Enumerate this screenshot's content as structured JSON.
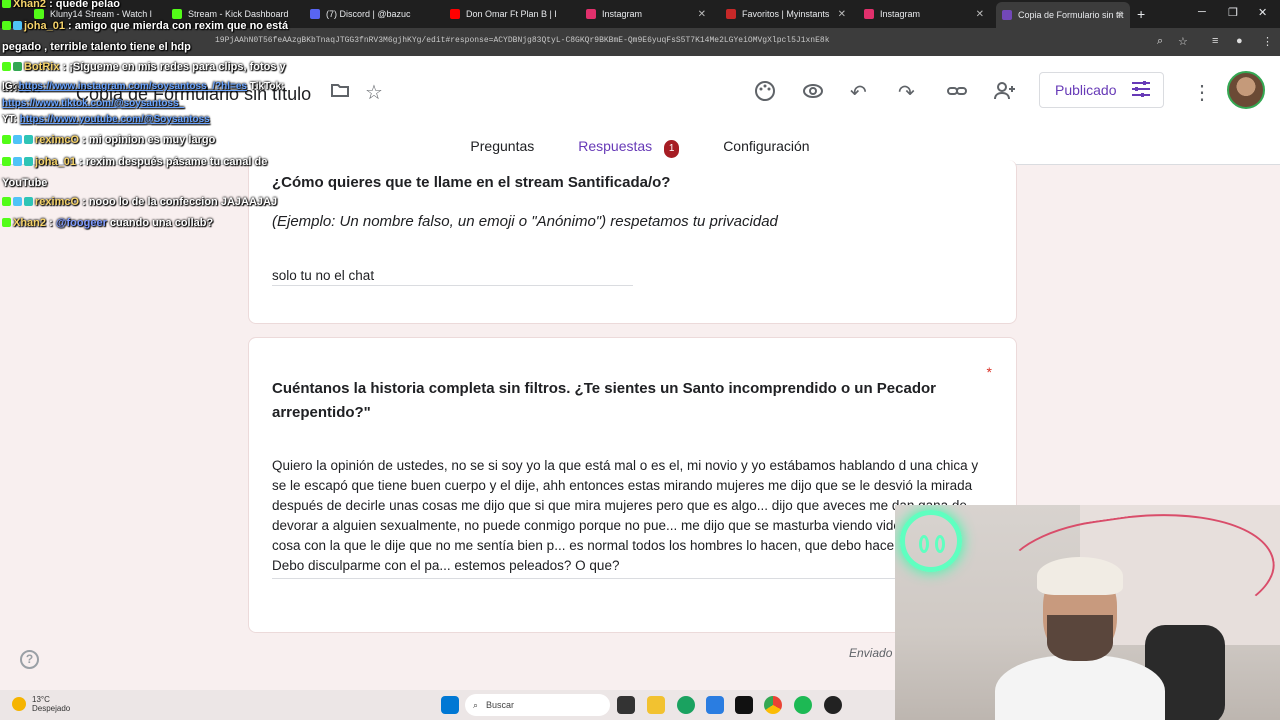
{
  "browser": {
    "tabs": [
      {
        "title": "Kluny14 Stream - Watch l",
        "color": "#53fc18",
        "active": false
      },
      {
        "title": "Stream - Kick Dashboard",
        "color": "#53fc18",
        "active": false
      },
      {
        "title": "(7) Discord | @bazuc",
        "color": "#5865f2",
        "active": false
      },
      {
        "title": "Don Omar Ft Plan B | Hoo",
        "color": "#ff0000",
        "active": false
      },
      {
        "title": "Instagram",
        "color": "#e1306c",
        "active": false
      },
      {
        "title": "Favoritos | Myinstants",
        "color": "#c62828",
        "active": false
      },
      {
        "title": "Instagram",
        "color": "#e1306c",
        "active": false
      },
      {
        "title": "Copia de Formulario sin tít",
        "color": "#7248b9",
        "active": true
      }
    ],
    "url": "19PjAAhN0T56feAAzgBKbTnaqJTGG3fnRV3M6gjhKYg/edit#response=ACYDBNjg83QtyL-C8GKQr9BKBmE-Qm9E6yuqFsS5T7K14Me2LGYeiOMVgXlpcl5J1xnE8k"
  },
  "form": {
    "title": "Copia de Formulario sin título",
    "publish_label": "Publicado",
    "tabs": {
      "questions": "Preguntas",
      "responses": "Respuestas",
      "responses_count": "1",
      "settings": "Configuración"
    },
    "q1": {
      "title": "¿Cómo quieres que te llame en el stream Santificada/o?",
      "description": "(Ejemplo: Un nombre falso, un emoji o \"Anónimo\") respetamos tu privacidad",
      "answer": "solo tu no el chat"
    },
    "q2": {
      "title": "Cuéntanos la historia completa sin filtros. ¿Te sientes un Santo incomprendido o un Pecador arrepentido?\"",
      "required_mark": "*",
      "answer": "Quiero la opinión de ustedes, no se si soy yo la que está mal o es el, mi novio y yo estábamos hablando d una chica y se le escapó que tiene buen cuerpo y el dije, ahh entonces estas mirando mujeres me dijo que se le desvió la mirada después de decirle unas cosas me dijo que si que mira mujeres pero que es algo... dijo que aveces me dan gana de devorar a alguien sexualmente, no puede conmigo porque no pue... me dijo que se masturba viendo videos de mujeres cosa con la que le dije que no me sentía bien p... es normal todos los hombres lo hacen, que debo hacer? Que opinan? Debo disculparme con el pa... estemos peleados? O que?"
    },
    "sent_label": "Enviado",
    "help_label": "?"
  },
  "chat": [
    {
      "user": "Xhan2",
      "sep": " : ",
      "text": "quede pelao"
    },
    {
      "user": "joha_01",
      "sep": " : ",
      "text": "amigo que mierda con rexim que no está pegado , terrible talento tiene el hdp"
    },
    {
      "user": "BotRix",
      "sep": " : ",
      "text": "¡Sígueme en mis redes para clips, fotos y avisos!"
    },
    {
      "prefix": "IG: ",
      "link": "https://www.instagram.com/soysantoss_/?hl=es",
      "prefix2": " TikTok: ",
      "link2": "https://www.tiktok.com/@soysantoss_"
    },
    {
      "prefix": "YT: ",
      "link": "https://www.youtube.com/@Soysantoss"
    },
    {
      "user": "reximcO",
      "sep": " : ",
      "text": "mi opinion es muy largo"
    },
    {
      "user": "joha_01",
      "sep": " : ",
      "text": "rexim después pásame tu canal de YouTube"
    },
    {
      "user": "reximcO",
      "sep": " : ",
      "text": "nooo lo de la confeccion JAJAAJAJ"
    },
    {
      "user": "Xhan2",
      "sep": " : ",
      "mention": "@foogeer",
      "text": " cuando una collab?"
    }
  ],
  "taskbar": {
    "temperature": "13°C",
    "weather": "Despejado",
    "search_placeholder": "Buscar"
  },
  "colors": {
    "accent": "#673ab7",
    "background": "#f8efef",
    "badge": "#a61d24",
    "required": "#d93025"
  }
}
